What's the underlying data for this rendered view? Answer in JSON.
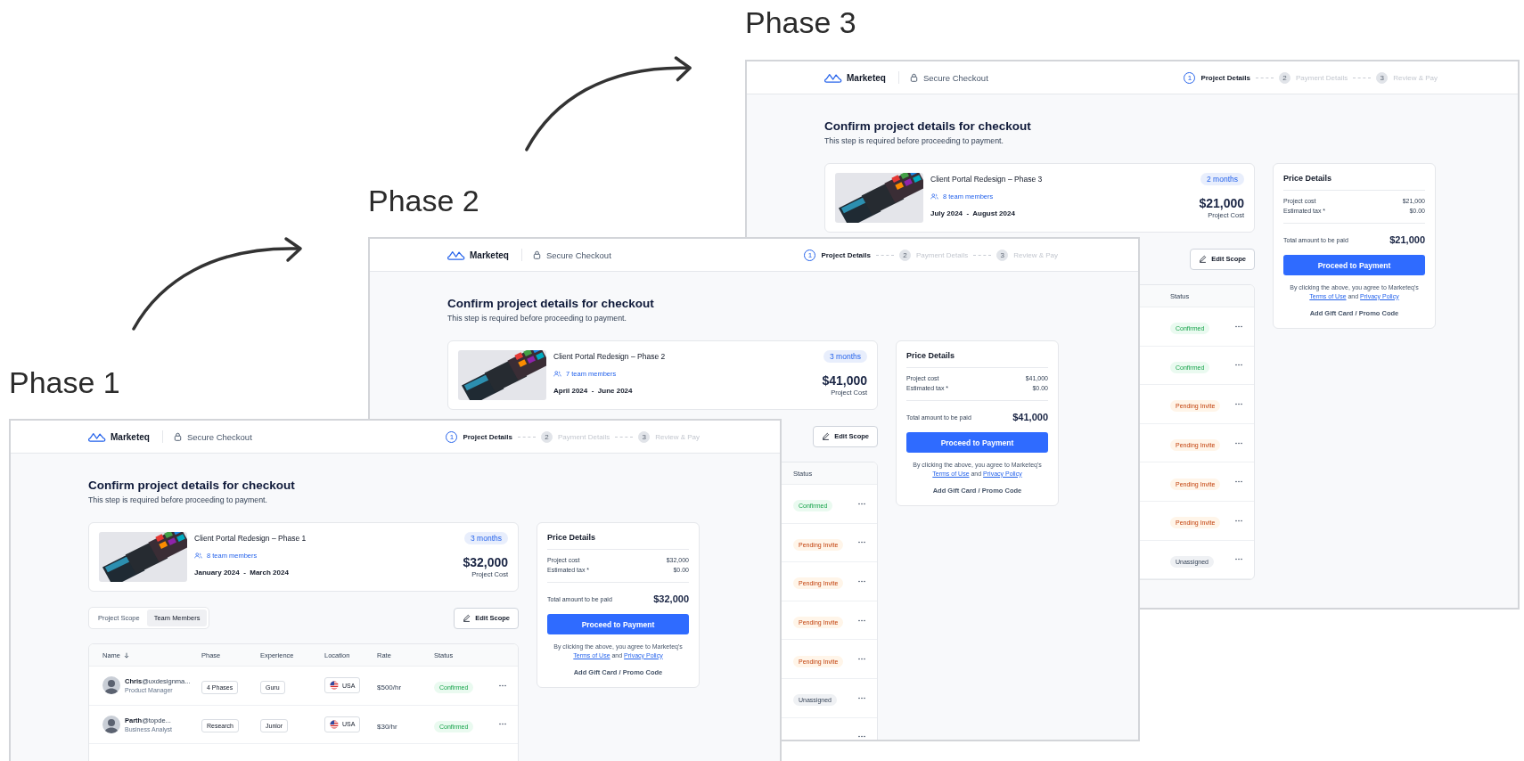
{
  "screens": [
    {
      "label": "Phase 3",
      "brand": "Marketeq",
      "checkout": "Secure Checkout",
      "steps": [
        {
          "number": "1",
          "label": "Project Details",
          "current": true
        },
        {
          "number": "2",
          "label": "Payment Details",
          "current": false
        },
        {
          "number": "3",
          "label": "Review & Pay",
          "current": false
        }
      ],
      "title": "Confirm project details for checkout",
      "subtitle": "This step is required before proceeding to payment.",
      "project": {
        "name": "Client Portal Redesign – Phase 3",
        "members": "8 team members",
        "dates": "July 2024  -  August 2024",
        "duration": "2 months",
        "price": "$21,000",
        "price_label": "Project Cost"
      },
      "price_details": {
        "title": "Price Details",
        "rows": [
          {
            "label": "Project cost",
            "value": "$21,000"
          },
          {
            "label": "Estimated tax *",
            "value": "$0.00"
          }
        ],
        "total_label": "Total amount to be paid",
        "total_value": "$21,000",
        "button": "Proceed to Payment",
        "agreement": "By clicking the above, you agree to Marketeq's",
        "terms": "Terms of Use",
        "joiner": "and",
        "privacy": "Privacy Policy",
        "promo": "Add Gift Card / Promo Code"
      },
      "edit_button": "Edit Scope",
      "table": {
        "columns": [
          {
            "kind": "status",
            "label": "Status",
            "sorted": false
          }
        ],
        "rows": [
          {
            "status": "Confirmed",
            "kind": "confirmed"
          },
          {
            "status": "Confirmed",
            "kind": "confirmed"
          },
          {
            "status": "Pending Invite",
            "kind": "pending"
          },
          {
            "status": "Pending Invite",
            "kind": "pending"
          },
          {
            "status": "Pending Invite",
            "kind": "pending"
          },
          {
            "status": "Pending Invite",
            "kind": "pending"
          },
          {
            "status": "Unassigned",
            "kind": "unassigned"
          }
        ]
      }
    },
    {
      "label": "Phase 2",
      "brand": "Marketeq",
      "checkout": "Secure Checkout",
      "steps": [
        {
          "number": "1",
          "label": "Project Details",
          "current": true
        },
        {
          "number": "2",
          "label": "Payment Details",
          "current": false
        },
        {
          "number": "3",
          "label": "Review & Pay",
          "current": false
        }
      ],
      "title": "Confirm project details for checkout",
      "subtitle": "This step is required before proceeding to payment.",
      "project": {
        "name": "Client Portal Redesign – Phase 2",
        "members": "7 team members",
        "dates": "April 2024  -  June 2024",
        "duration": "3 months",
        "price": "$41,000",
        "price_label": "Project Cost"
      },
      "price_details": {
        "title": "Price Details",
        "rows": [
          {
            "label": "Project cost",
            "value": "$41,000"
          },
          {
            "label": "Estimated tax *",
            "value": "$0.00"
          }
        ],
        "total_label": "Total amount to be paid",
        "total_value": "$41,000",
        "button": "Proceed to Payment",
        "agreement": "By clicking the above, you agree to Marketeq's",
        "terms": "Terms of Use",
        "joiner": "and",
        "privacy": "Privacy Policy",
        "promo": "Add Gift Card / Promo Code"
      },
      "edit_button": "Edit Scope",
      "table": {
        "columns": [
          {
            "kind": "status",
            "label": "Status",
            "sorted": false
          }
        ],
        "rows": [
          {
            "status": "Confirmed",
            "kind": "confirmed"
          },
          {
            "status": "Pending Invite",
            "kind": "pending"
          },
          {
            "status": "Pending Invite",
            "kind": "pending"
          },
          {
            "status": "Pending Invite",
            "kind": "pending"
          },
          {
            "status": "Pending Invite",
            "kind": "pending"
          },
          {
            "status": "Unassigned",
            "kind": "unassigned"
          },
          {
            "kind": "none"
          }
        ]
      }
    },
    {
      "label": "Phase 1",
      "brand": "Marketeq",
      "checkout": "Secure Checkout",
      "steps": [
        {
          "number": "1",
          "label": "Project Details",
          "current": true
        },
        {
          "number": "2",
          "label": "Payment Details",
          "current": false
        },
        {
          "number": "3",
          "label": "Review & Pay",
          "current": false
        }
      ],
      "title": "Confirm project details for checkout",
      "subtitle": "This step is required before proceeding to payment.",
      "project": {
        "name": "Client Portal Redesign – Phase 1",
        "members": "8 team members",
        "dates": "January 2024  -  March 2024",
        "duration": "3 months",
        "price": "$32,000",
        "price_label": "Project Cost"
      },
      "price_details": {
        "title": "Price Details",
        "rows": [
          {
            "label": "Project cost",
            "value": "$32,000"
          },
          {
            "label": "Estimated tax *",
            "value": "$0.00"
          }
        ],
        "total_label": "Total amount to be paid",
        "total_value": "$32,000",
        "button": "Proceed to Payment",
        "agreement": "By clicking the above, you agree to Marketeq's",
        "terms": "Terms of Use",
        "joiner": "and",
        "privacy": "Privacy Policy",
        "promo": "Add Gift Card / Promo Code"
      },
      "tabs": [
        {
          "label": "Project Scope",
          "selected": false
        },
        {
          "label": "Team Members",
          "selected": true
        }
      ],
      "edit_button": "Edit Scope",
      "table": {
        "columns": [
          {
            "kind": "name",
            "label": "Name",
            "sorted": true
          },
          {
            "kind": "phase",
            "label": "Phase",
            "sorted": false
          },
          {
            "kind": "experience",
            "label": "Experience",
            "sorted": false
          },
          {
            "kind": "location",
            "label": "Location",
            "sorted": false
          },
          {
            "kind": "rate",
            "label": "Rate",
            "sorted": false
          },
          {
            "kind": "status",
            "label": "Status",
            "sorted": false
          }
        ],
        "rows": [
          {
            "person": "**Chris**@uxdesignma...",
            "role": "Product Manager",
            "phase": "4 Phases",
            "experience": "Guru",
            "location": "USA",
            "rate": "$500/hr",
            "status": "Confirmed",
            "kind": "confirmed"
          },
          {
            "person": "**Parth**@topde...",
            "role": "Business Analyst",
            "phase": "Research",
            "experience": "Junior",
            "location": "USA",
            "rate": "$30/hr",
            "status": "Confirmed",
            "kind": "confirmed"
          }
        ]
      }
    }
  ]
}
